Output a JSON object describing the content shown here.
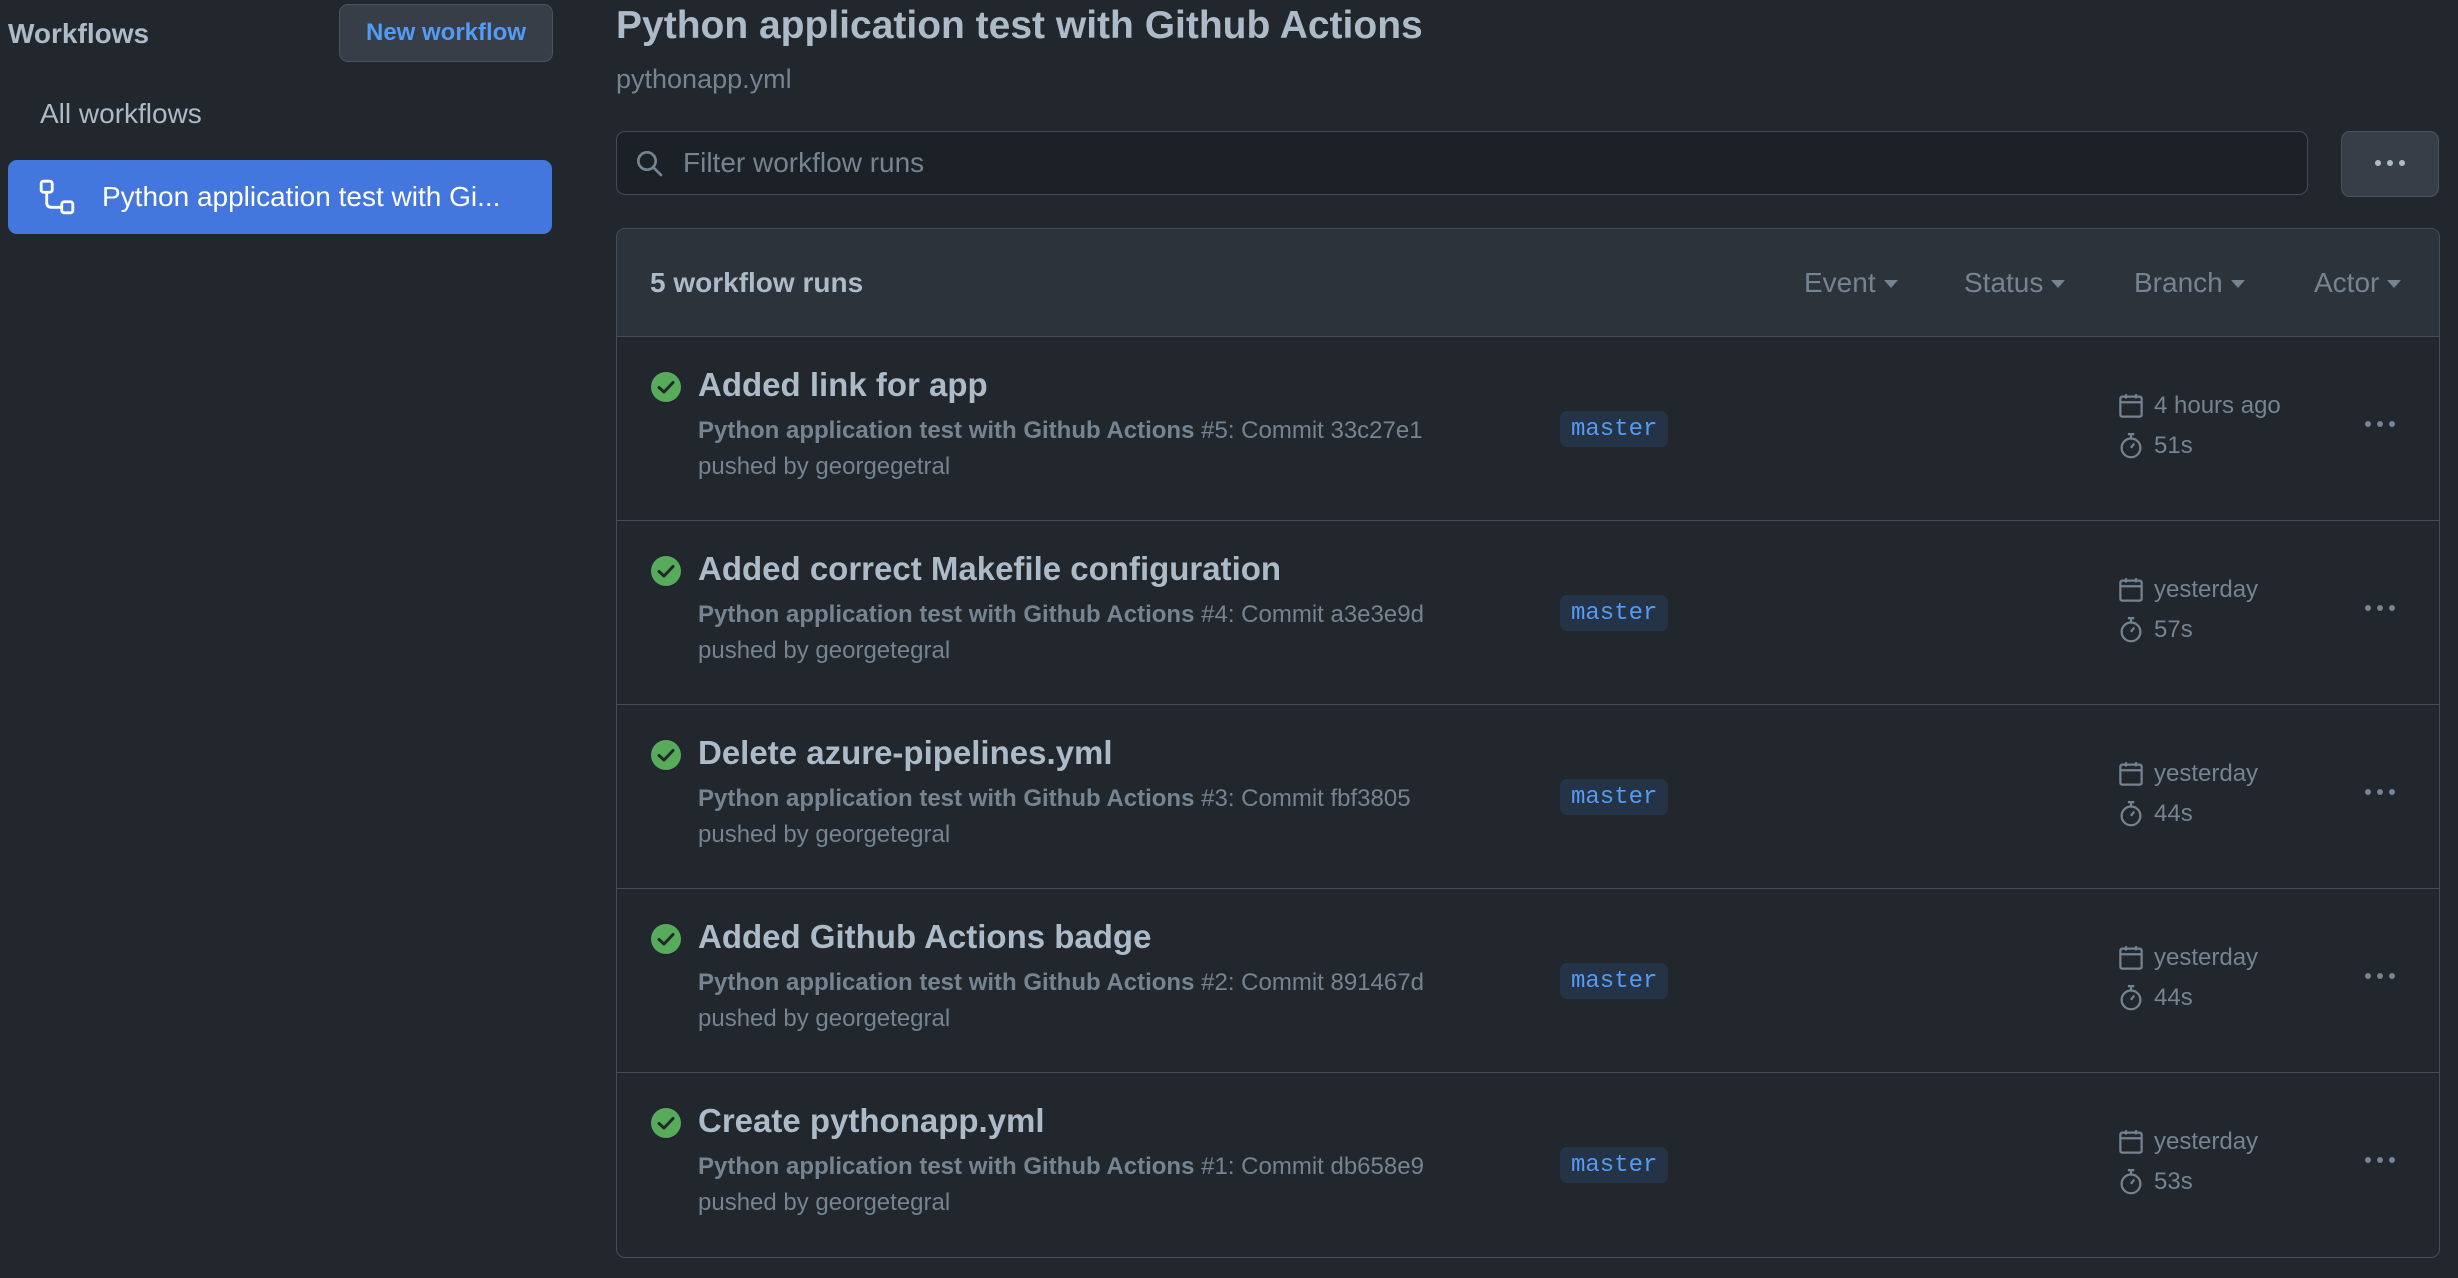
{
  "sidebar": {
    "title": "Workflows",
    "new_workflow_label": "New workflow",
    "all_workflows_label": "All workflows",
    "active_workflow_label": "Python application test with Gi..."
  },
  "header": {
    "title": "Python application test with Github Actions",
    "subtitle": "pythonapp.yml"
  },
  "filter": {
    "placeholder": "Filter workflow runs",
    "value": ""
  },
  "runs_header": {
    "count_label": "5 workflow runs",
    "filters": [
      "Event",
      "Status",
      "Branch",
      "Actor"
    ]
  },
  "runs": [
    {
      "title": "Added link for app",
      "workflow_name": "Python application test with Github Actions",
      "run_info": " #5: Commit 33c27e1",
      "pushed_by": "pushed by georgegetral",
      "branch": "master",
      "time": "4 hours ago",
      "duration": "51s",
      "status": "success"
    },
    {
      "title": "Added correct Makefile configuration",
      "workflow_name": "Python application test with Github Actions",
      "run_info": " #4: Commit a3e3e9d",
      "pushed_by": "pushed by georgetegral",
      "branch": "master",
      "time": "yesterday",
      "duration": "57s",
      "status": "success"
    },
    {
      "title": "Delete azure-pipelines.yml",
      "workflow_name": "Python application test with Github Actions",
      "run_info": " #3: Commit fbf3805",
      "pushed_by": "pushed by georgetegral",
      "branch": "master",
      "time": "yesterday",
      "duration": "44s",
      "status": "success"
    },
    {
      "title": "Added Github Actions badge",
      "workflow_name": "Python application test with Github Actions",
      "run_info": " #2: Commit 891467d",
      "pushed_by": "pushed by georgetegral",
      "branch": "master",
      "time": "yesterday",
      "duration": "44s",
      "status": "success"
    },
    {
      "title": "Create pythonapp.yml",
      "workflow_name": "Python application test with Github Actions",
      "run_info": " #1: Commit db658e9",
      "pushed_by": "pushed by georgetegral",
      "branch": "master",
      "time": "yesterday",
      "duration": "53s",
      "status": "success"
    }
  ],
  "colors": {
    "background": "#22272e",
    "accent": "#539bf5",
    "active_item": "#4477dd",
    "success": "#57ab5a"
  },
  "icons": {
    "workflow": "workflow-icon",
    "search": "search-icon",
    "more": "kebab-horizontal-icon",
    "status": "check-circle-fill-icon",
    "calendar": "calendar-icon",
    "stopwatch": "stopwatch-icon"
  }
}
